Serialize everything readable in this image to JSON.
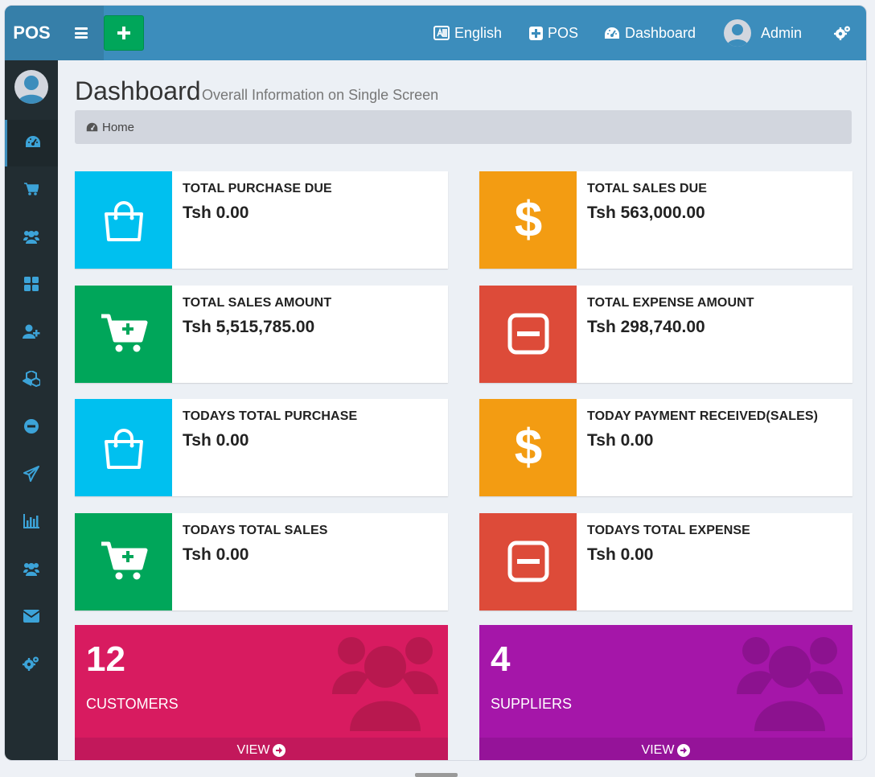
{
  "app": {
    "brand": "POS"
  },
  "topnav": {
    "language": "English",
    "pos": "POS",
    "dashboard": "Dashboard",
    "user": "Admin"
  },
  "page": {
    "title": "Dashboard",
    "subtitle": "Overall Information on Single Screen"
  },
  "breadcrumb": {
    "home": "Home"
  },
  "sidebar": {
    "items": [
      "dashboard-icon",
      "cart-icon",
      "users-icon",
      "grid-icon",
      "user-plus-icon",
      "cubes-icon",
      "minus-circle-icon",
      "paper-plane-icon",
      "bar-chart-icon",
      "users-icon",
      "envelope-icon",
      "gears-icon"
    ]
  },
  "colors": {
    "aqua": "#00c0ef",
    "yellow": "#f39c12",
    "green": "#00a65a",
    "red": "#dd4b39",
    "maroon": "#d81b60",
    "purple": "#a516a9",
    "topbar": "#3c8dbc",
    "sidebar": "#222d32"
  },
  "info_boxes": [
    {
      "label": "TOTAL PURCHASE DUE",
      "value": "Tsh 0.00",
      "icon": "shopping-bag-icon",
      "color": "aqua"
    },
    {
      "label": "TOTAL SALES DUE",
      "value": "Tsh 563,000.00",
      "icon": "dollar-icon",
      "color": "yellow"
    },
    {
      "label": "TOTAL SALES AMOUNT",
      "value": "Tsh 5,515,785.00",
      "icon": "cart-plus-icon",
      "color": "green"
    },
    {
      "label": "TOTAL EXPENSE AMOUNT",
      "value": "Tsh 298,740.00",
      "icon": "minus-square-icon",
      "color": "red"
    },
    {
      "label": "TODAYS TOTAL PURCHASE",
      "value": "Tsh 0.00",
      "icon": "shopping-bag-icon",
      "color": "aqua"
    },
    {
      "label": "TODAY PAYMENT RECEIVED(SALES)",
      "value": "Tsh 0.00",
      "icon": "dollar-icon",
      "color": "yellow"
    },
    {
      "label": "TODAYS TOTAL SALES",
      "value": "Tsh 0.00",
      "icon": "cart-plus-icon",
      "color": "green"
    },
    {
      "label": "TODAYS TOTAL EXPENSE",
      "value": "Tsh 0.00",
      "icon": "minus-square-icon",
      "color": "red"
    }
  ],
  "small_boxes": [
    {
      "count": "12",
      "label": "CUSTOMERS",
      "link": "VIEW",
      "icon": "users-icon",
      "color": "maroon"
    },
    {
      "count": "4",
      "label": "SUPPLIERS",
      "link": "VIEW",
      "icon": "users-icon",
      "color": "purple"
    }
  ]
}
